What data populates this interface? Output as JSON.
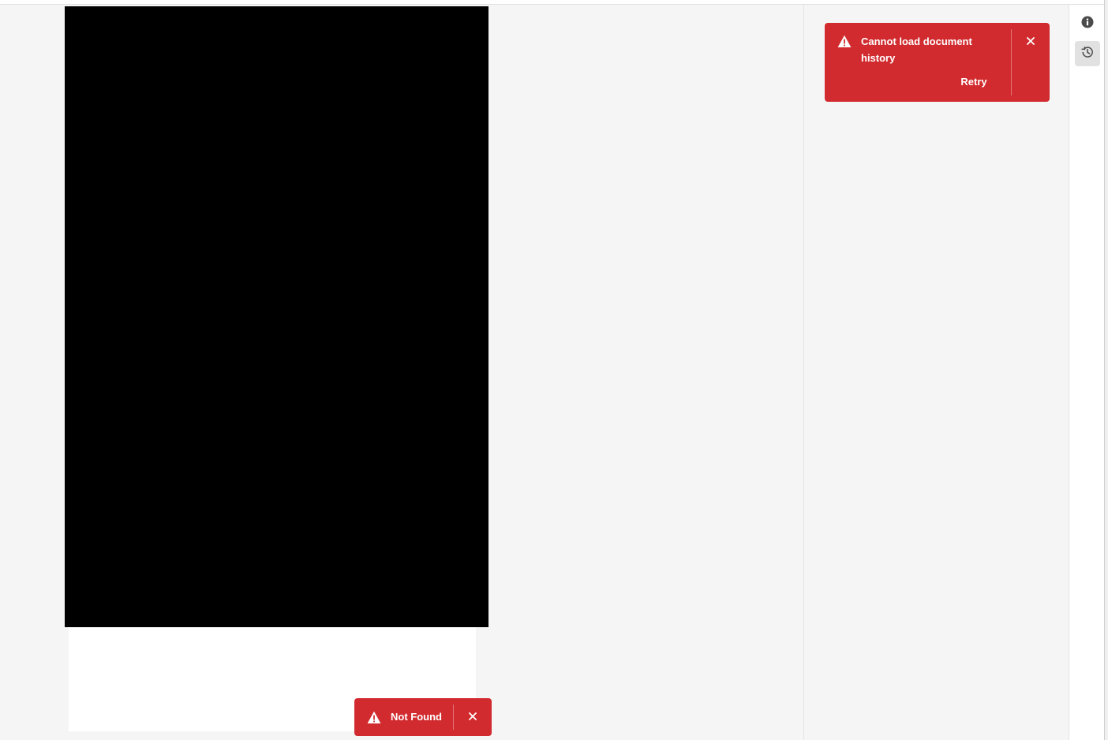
{
  "history_toast": {
    "message": "Cannot load document history",
    "action_label": "Retry",
    "icon": "alert-triangle-icon",
    "close_icon": "close-icon"
  },
  "notfound_toast": {
    "message": "Not Found",
    "icon": "alert-triangle-icon",
    "close_icon": "close-icon"
  },
  "rail": {
    "items": [
      {
        "icon": "info-icon",
        "active": false
      },
      {
        "icon": "history-icon",
        "active": true
      }
    ]
  },
  "colors": {
    "toast_negative": "#d22b2f",
    "background": "#f5f5f5",
    "rail_active": "#e1e1e1"
  }
}
